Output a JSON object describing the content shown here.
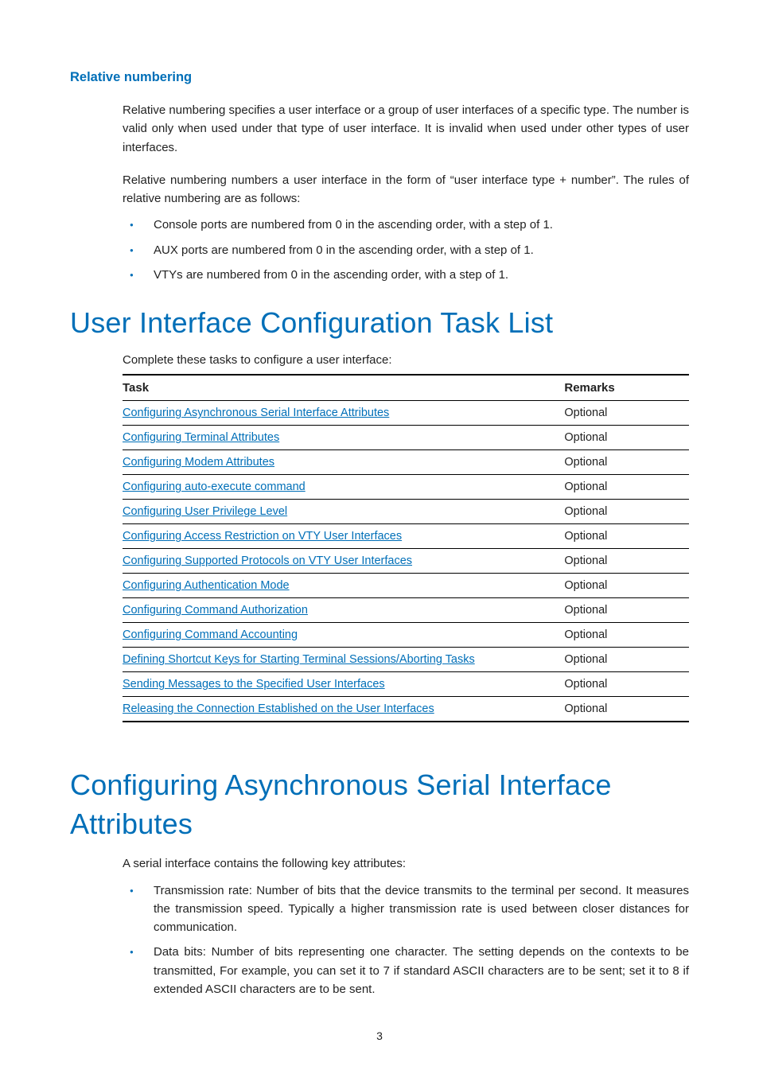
{
  "headings": {
    "h3_relnum": "Relative numbering",
    "h1_tasklist": "User Interface Configuration Task List",
    "h1_async": "Configuring Asynchronous Serial Interface Attributes"
  },
  "relnum": {
    "p1": "Relative numbering specifies a user interface or a group of user interfaces of a specific type. The number is valid only when used under that type of user interface. It is invalid when used under other types of user interfaces.",
    "p2": "Relative numbering numbers a user interface in the form of “user interface type + number”. The rules of relative numbering are as follows:",
    "bullets": [
      "Console ports are numbered from 0 in the ascending order, with a step of 1.",
      "AUX ports are numbered from 0 in the ascending order, with a step of 1.",
      "VTYs are numbered from 0 in the ascending order, with a step of 1."
    ]
  },
  "tasklist": {
    "intro": "Complete these tasks to configure a user interface:",
    "headers": {
      "task": "Task",
      "remarks": "Remarks"
    },
    "rows": [
      {
        "task": "Configuring Asynchronous Serial Interface Attributes",
        "remarks": "Optional"
      },
      {
        "task": "Configuring Terminal Attributes",
        "remarks": "Optional"
      },
      {
        "task": "Configuring Modem Attributes",
        "remarks": "Optional"
      },
      {
        "task": "Configuring auto-execute command",
        "remarks": "Optional"
      },
      {
        "task": "Configuring User Privilege Level",
        "remarks": "Optional"
      },
      {
        "task": "Configuring Access Restriction on VTY User Interfaces",
        "remarks": "Optional"
      },
      {
        "task": "Configuring Supported Protocols on VTY User Interfaces",
        "remarks": "Optional"
      },
      {
        "task": "Configuring Authentication Mode",
        "remarks": "Optional"
      },
      {
        "task": "Configuring Command Authorization",
        "remarks": "Optional"
      },
      {
        "task": "Configuring Command Accounting",
        "remarks": "Optional"
      },
      {
        "task": "Defining Shortcut Keys for Starting Terminal Sessions/Aborting Tasks",
        "remarks": "Optional"
      },
      {
        "task": "Sending Messages to the Specified User Interfaces",
        "remarks": "Optional"
      },
      {
        "task": "Releasing the Connection Established on the User Interfaces",
        "remarks": "Optional"
      }
    ]
  },
  "async": {
    "intro": "A serial interface contains the following key attributes:",
    "bullets": [
      "Transmission rate: Number of bits that the device transmits to the terminal per second. It measures the transmission speed. Typically a higher transmission rate is used between closer distances for communication.",
      "Data bits: Number of bits representing one character. The setting depends on the contexts to be transmitted, For example, you can set it to 7 if standard ASCII characters are to be sent; set it to 8 if extended ASCII characters are to be sent."
    ]
  },
  "page_number": "3"
}
